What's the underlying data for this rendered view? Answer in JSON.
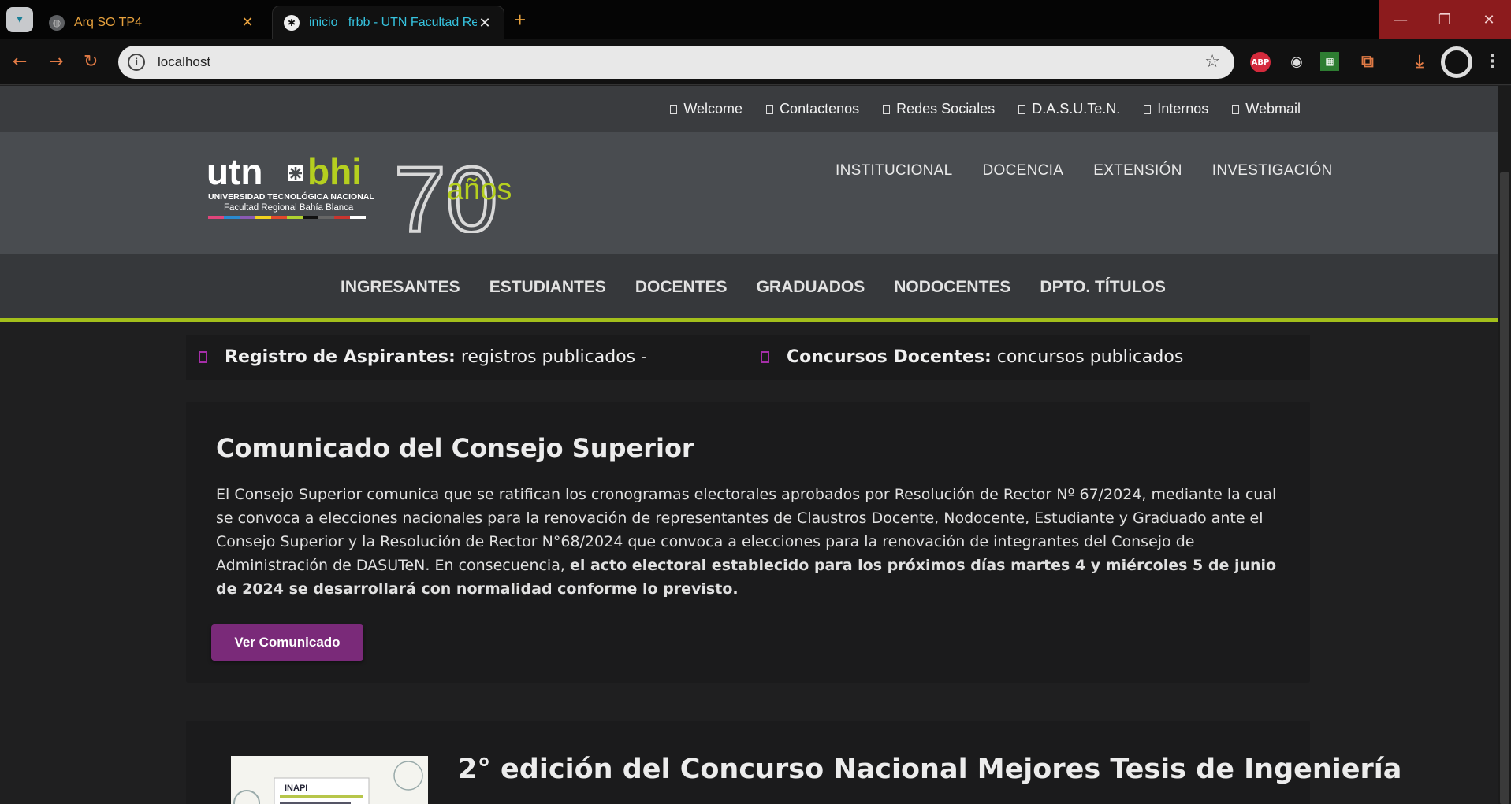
{
  "browser": {
    "tabs": [
      {
        "title": "Arq SO TP4",
        "active": false
      },
      {
        "title": "inicio _frbb - UTN Facultad Regi",
        "active": true
      }
    ],
    "url": "localhost"
  },
  "topbar": {
    "links": [
      "Welcome",
      "Contactenos",
      "Redes Sociales",
      "D.A.S.U.Te.N.",
      "Internos",
      "Webmail"
    ]
  },
  "header": {
    "logo": {
      "utn": "utn",
      "bhi": "bhi",
      "line1": "UNIVERSIDAD TECNOLÓGICA NACIONAL",
      "line2": "Facultad Regional Bahía Blanca",
      "anniv_number": "70",
      "anniv_word": "años"
    },
    "nav": [
      "INSTITUCIONAL",
      "DOCENCIA",
      "EXTENSIÓN",
      "INVESTIGACIÓN"
    ]
  },
  "secondary_nav": [
    "INGRESANTES",
    "ESTUDIANTES",
    "DOCENTES",
    "GRADUADOS",
    "NODOCENTES",
    "DPTO. TÍTULOS"
  ],
  "ticker": [
    {
      "label": "Registro de Aspirantes:",
      "text": "registros publicados -"
    },
    {
      "label": "Concursos Docentes:",
      "text": "concursos publicados"
    }
  ],
  "announcement": {
    "title": "Comunicado del Consejo Superior",
    "body": "El Consejo Superior comunica que se ratifican los cronogramas electorales aprobados por Resolución de Rector Nº 67/2024, mediante la cual se convoca a elecciones nacionales para la renovación de representantes de Claustros Docente, Nodocente, Estudiante y Graduado ante el Consejo Superior y la Resolución de Rector N°68/2024 que convoca a elecciones para la renovación de integrantes del Consejo de Administración de DASUTeN. En consecuencia,",
    "body_bold": "el acto electoral establecido para los próximos días martes 4 y miércoles 5 de junio de 2024 se desarrollará con normalidad conforme lo previsto.",
    "button": "Ver Comunicado"
  },
  "news": {
    "title": "2° edición del Concurso Nacional Mejores Tesis de Ingeniería",
    "image_text": "INAPI"
  },
  "colors": {
    "accent_green": "#a3bf1b",
    "accent_purple": "#7a2a79"
  }
}
